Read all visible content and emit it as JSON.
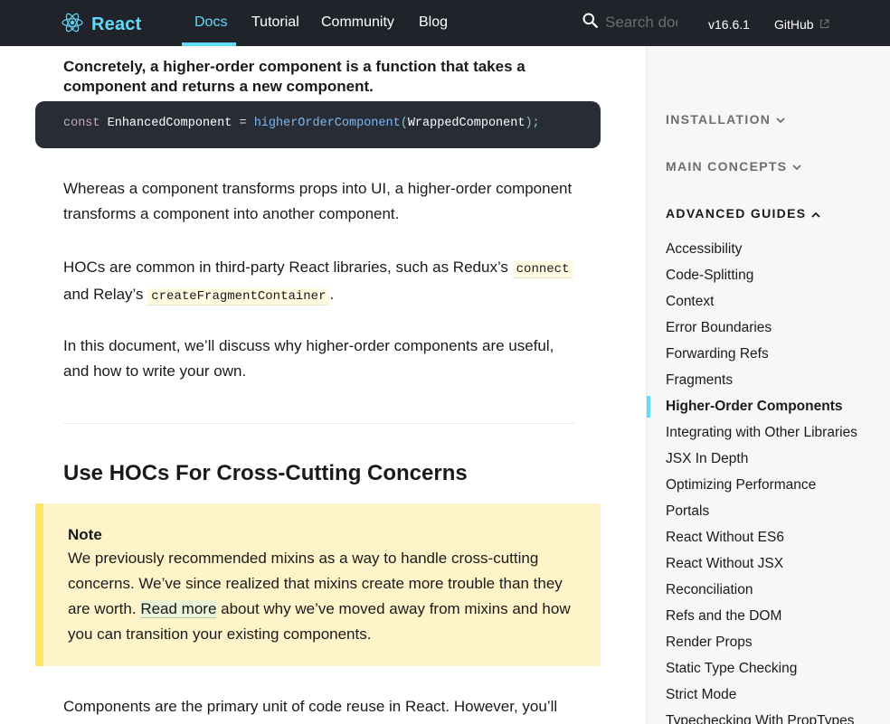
{
  "nav": {
    "logo_text": "React",
    "links": [
      "Docs",
      "Tutorial",
      "Community",
      "Blog"
    ],
    "search_placeholder": "Search docs",
    "version": "v16.6.1",
    "github": "GitHub"
  },
  "content": {
    "lead_line1": "Concretely, a higher-order component is a function that takes a",
    "lead_line2": "component and returns a new component.",
    "code": {
      "kw": "const",
      "var": "EnhancedComponent",
      "op": "=",
      "fn": "higherOrderComponent",
      "open": "(",
      "arg": "WrappedComponent",
      "close": ");"
    },
    "para1": "Whereas a component transforms props into UI, a higher-order component transforms a component into another component.",
    "para2_before": "HOCs are common in third-party React libraries, such as Redux’s ",
    "para2_code1": "connect",
    "para2_mid": " and Relay’s ",
    "para2_code2": "createFragmentContainer",
    "para2_after": ".",
    "para3": "In this document, we’ll discuss why higher-order components are useful, and how to write your own.",
    "section_title": "Use HOCs For Cross-Cutting Concerns",
    "note": {
      "title": "Note",
      "body_before": "We previously recommended mixins as a way to handle cross-cutting concerns. We’ve since realized that mixins create more trouble than they are worth. ",
      "link": "Read more",
      "body_after": " about why we’ve moved away from mixins and how you can transition your existing components."
    },
    "para4": "Components are the primary unit of code reuse in React. However, you’ll"
  },
  "sidebar": {
    "sections": [
      "INSTALLATION",
      "MAIN CONCEPTS",
      "ADVANCED GUIDES"
    ],
    "items": [
      "Accessibility",
      "Code-Splitting",
      "Context",
      "Error Boundaries",
      "Forwarding Refs",
      "Fragments",
      "Higher-Order Components",
      "Integrating with Other Libraries",
      "JSX In Depth",
      "Optimizing Performance",
      "Portals",
      "React Without ES6",
      "React Without JSX",
      "Reconciliation",
      "Refs and the DOM",
      "Render Props",
      "Static Type Checking",
      "Strict Mode",
      "Typechecking With PropTypes"
    ],
    "active_item": "Higher-Order Components"
  },
  "colors": {
    "brand": "#61dafb",
    "nav_bg": "#20232a",
    "code_bg": "#282c34",
    "note_bg": "#fff4c9",
    "note_border": "#ffe564",
    "sidebar_bg": "#f7f7f7"
  }
}
